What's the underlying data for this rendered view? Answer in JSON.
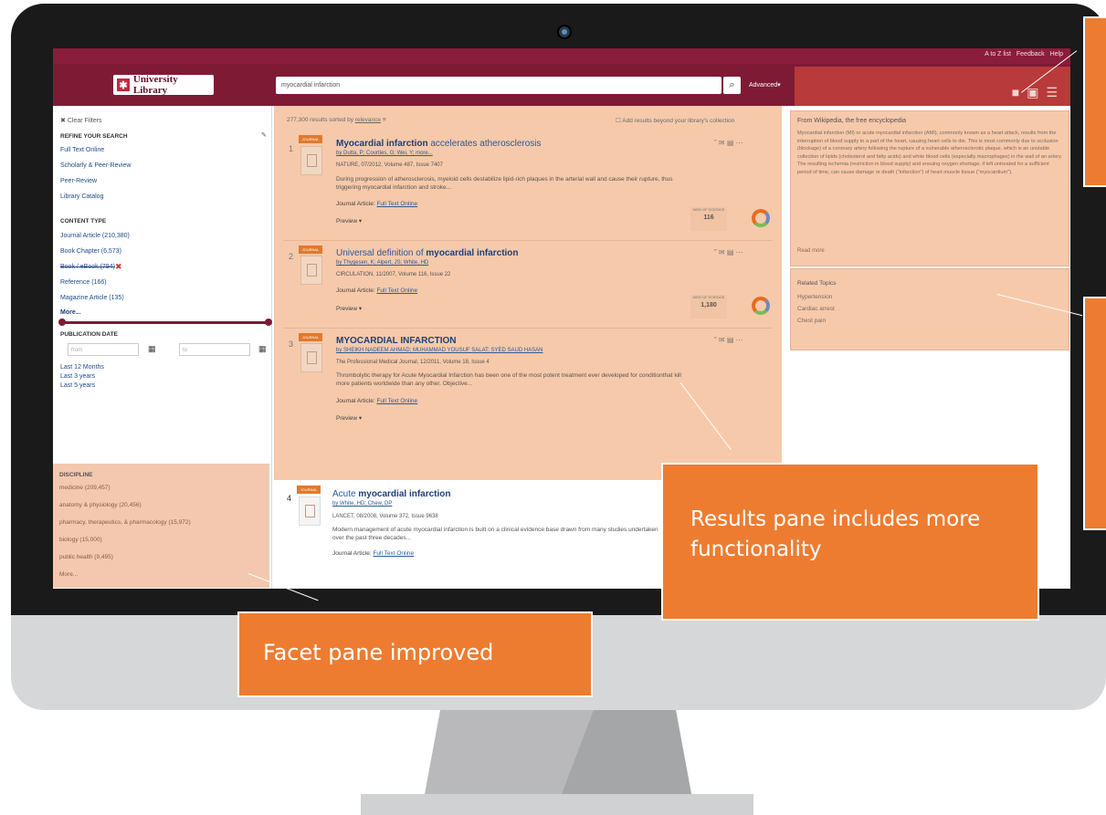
{
  "header": {
    "top_links": [
      "A to Z list",
      "Feedback",
      "Help"
    ],
    "logo_text": "University Library",
    "search_query": "myocardial infarction",
    "advanced_label": "Advanced▾"
  },
  "sidebar": {
    "clear_filters": "Clear Filters",
    "refine_heading": "REFINE YOUR SEARCH",
    "refine_items": [
      "Full Text Online",
      "Scholarly & Peer-Review",
      "Peer-Review",
      "Library Catalog"
    ],
    "content_type_heading": "CONTENT TYPE",
    "content_types": [
      "Journal Article (210,380)",
      "Book Chapter (6,573)",
      "Book / eBook (794)",
      "Reference (166)",
      "Magazine Article (135)"
    ],
    "more_label": "More...",
    "pub_date_heading": "PUBLICATION DATE",
    "date_from_placeholder": "from",
    "date_to_placeholder": "to",
    "date_links": [
      "Last 12 Months",
      "Last 3 years",
      "Last 5 years"
    ],
    "discipline_heading": "DISCIPLINE",
    "disciplines": [
      "medicine (209,457)",
      "anatomy & physiology (20,456)",
      "pharmacy, therapeutics, & pharmacology (15,972)",
      "biology (15,000)",
      "public health (9,495)"
    ],
    "discipline_more": "More..."
  },
  "results": {
    "summary": "277,300 results sorted by",
    "sort_label": "relevance",
    "beyond_collection": "Add results beyond your library's collection",
    "items": [
      {
        "num": "1",
        "badge": "JOURNAL",
        "title_bold": "Myocardial infarction",
        "title_rest": " accelerates atherosclerosis",
        "authors": "by Dutta, P; Courties, G; Wei, Y; more...",
        "source": "NATURE, 07/2012, Volume 487, Issue 7407",
        "snippet": "During progression of atherosclerosis, myeloid cells destabilize lipid-rich plaques in the arterial wall and cause their rupture, thus triggering myocardial infarction and stroke...",
        "type": "Journal Article:",
        "access": "Full Text Online",
        "preview": "Preview ▾",
        "wos_label": "WEB OF SCIENCE",
        "wos_count": "116"
      },
      {
        "num": "2",
        "badge": "JOURNAL",
        "title_bold": "myocardial infarction",
        "title_rest": "Universal definition of ",
        "authors": "by Thygesen, K; Alpert, JS; White, HD",
        "source": "CIRCULATION, 11/2007, Volume 116, Issue 22",
        "snippet": "",
        "type": "Journal Article:",
        "access": "Full Text Online",
        "preview": "Preview ▾",
        "wos_label": "WEB OF SCIENCE",
        "wos_count": "1,180"
      },
      {
        "num": "3",
        "badge": "JOURNAL",
        "title_bold": "MYOCARDIAL INFARCTION",
        "title_rest": "",
        "authors": "by SHEIKH NADEEM AHMAD; MUHAMMAD YOUSUF SALAT; SYED SAUD HASAN",
        "source": "The Professional Medical Journal, 12/2011, Volume 18, Issue 4",
        "snippet": "Thrombolytic therapy for Acute Myocardial Infarction has been one of the most potent treatment ever developed for conditionthat kill more patients worldwide than any other. Objective...",
        "type": "Journal Article:",
        "access": "Full Text Online",
        "preview": "Preview ▾",
        "wos_label": "",
        "wos_count": ""
      },
      {
        "num": "4",
        "badge": "JOURNAL",
        "title_bold": "myocardial infarction",
        "title_rest": "Acute ",
        "authors": "by White, HD; Chew, DP",
        "source": "LANCET, 08/2008, Volume 372, Issue 9638",
        "snippet": "Modern management of acute myocardial infarction is built on a clinical evidence base drawn from many studies undertaken over the past three decades...",
        "type": "Journal Article:",
        "access": "Full Text Online",
        "preview": "",
        "wos_label": "",
        "wos_count": ""
      }
    ]
  },
  "right_pane": {
    "wiki_source": "From Wikipedia, the free encyclopedia",
    "wiki_text": "Myocardial infarction (MI) or acute myocardial infarction (AMI), commonly known as a heart attack, results from the interruption of blood supply to a part of the heart, causing heart cells to die. This is most commonly due to occlusion (blockage) of a coronary artery following the rupture of a vulnerable atherosclerotic plaque, which is an unstable collection of lipids (cholesterol and fatty acids) and white blood cells (especially macrophages) in the wall of an artery. The resulting ischemia (restriction in blood supply) and ensuing oxygen shortage, if left untreated for a sufficient period of time, can cause damage or death (\"infarction\") of heart muscle tissue (\"myocardium\").",
    "read_more": "Read more",
    "related_heading": "Related Topics",
    "related_topics": [
      "Hypertension",
      "Cardiac arrest",
      "Chest pain"
    ]
  },
  "callouts": {
    "results_pane": "Results pane includes more functionality",
    "facet_pane": "Facet pane improved"
  },
  "colors": {
    "header": "#7f1a35",
    "callout": "#ee7c30",
    "highlight": "#f6c9aa"
  }
}
